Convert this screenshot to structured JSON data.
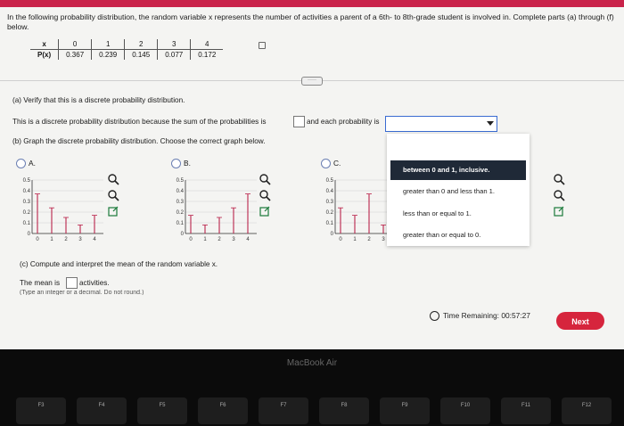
{
  "question": {
    "intro": "In the following probability distribution, the random variable x represents the number of activities a parent of a 6th- to 8th-grade student is involved in. Complete parts (a) through (f) below."
  },
  "table": {
    "x_label": "x",
    "p_label": "P(x)",
    "x_values": [
      "0",
      "1",
      "2",
      "3",
      "4"
    ],
    "p_values": [
      "0.367",
      "0.239",
      "0.145",
      "0.077",
      "0.172"
    ]
  },
  "more_button": "·····",
  "part_a": {
    "title": "(a) Verify that this is a discrete probability distribution.",
    "sentence_start": "This is a discrete probability distribution because the sum of the probabilities is",
    "sentence_mid": "and each probability is"
  },
  "dropdown": {
    "options": [
      "between 0 and 1, inclusive.",
      "greater than 0 and less than 1.",
      "less than or equal to 1.",
      "greater than or equal to 0."
    ],
    "selected_index": 0
  },
  "part_b": {
    "title": "(b) Graph the discrete probability distribution. Choose the correct graph below.",
    "options": [
      "A.",
      "B.",
      "C."
    ]
  },
  "graph": {
    "y_ticks": [
      "0.5",
      "0.4",
      "0.3",
      "0.2",
      "0.1",
      "0"
    ],
    "x_ticks": [
      "0",
      "1",
      "2",
      "3",
      "4"
    ],
    "option_a": [
      0.37,
      0.24,
      0.15,
      0.08,
      0.17
    ],
    "option_b": [
      0.17,
      0.08,
      0.15,
      0.24,
      0.37
    ],
    "option_c": [
      0.24,
      0.17,
      0.37,
      0.08,
      0.15
    ]
  },
  "part_c": {
    "title": "(c) Compute and interpret the mean of the random variable x.",
    "mean_prefix": "The mean is",
    "mean_suffix": "activities.",
    "hint": "(Type an integer or a decimal. Do not round.)"
  },
  "footer": {
    "timer_label": "Time Remaining:",
    "timer_value": "00:57:27",
    "next_label": "Next"
  },
  "device": {
    "brand": "MacBook Air",
    "keys": [
      "F3",
      "F4",
      "F5",
      "F6",
      "F7",
      "F8",
      "F9",
      "F10",
      "F11",
      "F12"
    ]
  },
  "colors": {
    "accent_red": "#d6253d",
    "top_bar": "#c9234a",
    "selected_item": "#1f2937",
    "graph_line": "#b9234a"
  }
}
